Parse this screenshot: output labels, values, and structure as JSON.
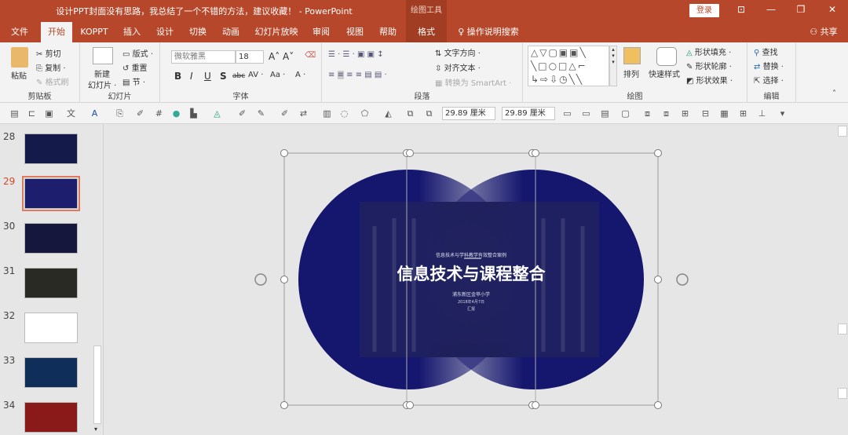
{
  "window": {
    "title": "设计PPT封面没有思路，我总结了一个不错的方法，建议收藏！ - PowerPoint",
    "context_tool": "绘图工具",
    "login": "登录",
    "share": "共享"
  },
  "tabs": [
    "文件",
    "开始",
    "KOPPT",
    "插入",
    "设计",
    "切换",
    "动画",
    "幻灯片放映",
    "审阅",
    "视图",
    "帮助",
    "格式"
  ],
  "search": "操作说明搜索",
  "ribbon": {
    "clipboard": {
      "label": "剪贴板",
      "paste": "粘贴",
      "cut": "剪切",
      "copy": "复制",
      "format_painter": "格式刷"
    },
    "slides": {
      "label": "幻灯片",
      "new_slide_1": "新建",
      "new_slide_2": "幻灯片 ·",
      "layout": "版式 ·",
      "reset": "重置",
      "section": "节 ·"
    },
    "font": {
      "label": "字体",
      "font_name": "微软雅黑",
      "font_size": "18",
      "bold": "B",
      "italic": "I",
      "underline": "U",
      "shadow": "S",
      "strike": "abc",
      "spacing": "AV ·",
      "case": "Aa ·",
      "color": "A ·"
    },
    "paragraph": {
      "label": "段落",
      "text_direction": "文字方向 ·",
      "align_text": "对齐文本 ·",
      "smartart": "转换为 SmartArt ·"
    },
    "drawing": {
      "label": "绘图",
      "arrange": "排列",
      "quick_styles": "快速样式",
      "fill": "形状填充 ·",
      "outline": "形状轮廓 ·",
      "effects": "形状效果 ·"
    },
    "editing": {
      "label": "编辑",
      "find": "查找",
      "replace": "替换 ·",
      "select": "选择 ·"
    }
  },
  "format_bar": {
    "height": "29.89 厘米",
    "width": "29.89 厘米"
  },
  "thumbnails": [
    {
      "num": "28"
    },
    {
      "num": "29",
      "selected": true
    },
    {
      "num": "30"
    },
    {
      "num": "31"
    },
    {
      "num": "32"
    },
    {
      "num": "33"
    },
    {
      "num": "34"
    }
  ],
  "slide": {
    "subtitle": "信息技术与学科教学有效整合案例",
    "title": "信息技术与课程整合",
    "school": "浦东新区金苹小学",
    "date": "2018年4月7日",
    "presenter": "汇报"
  },
  "colors": {
    "accent": "#b7472a",
    "circle": "#15166e"
  }
}
